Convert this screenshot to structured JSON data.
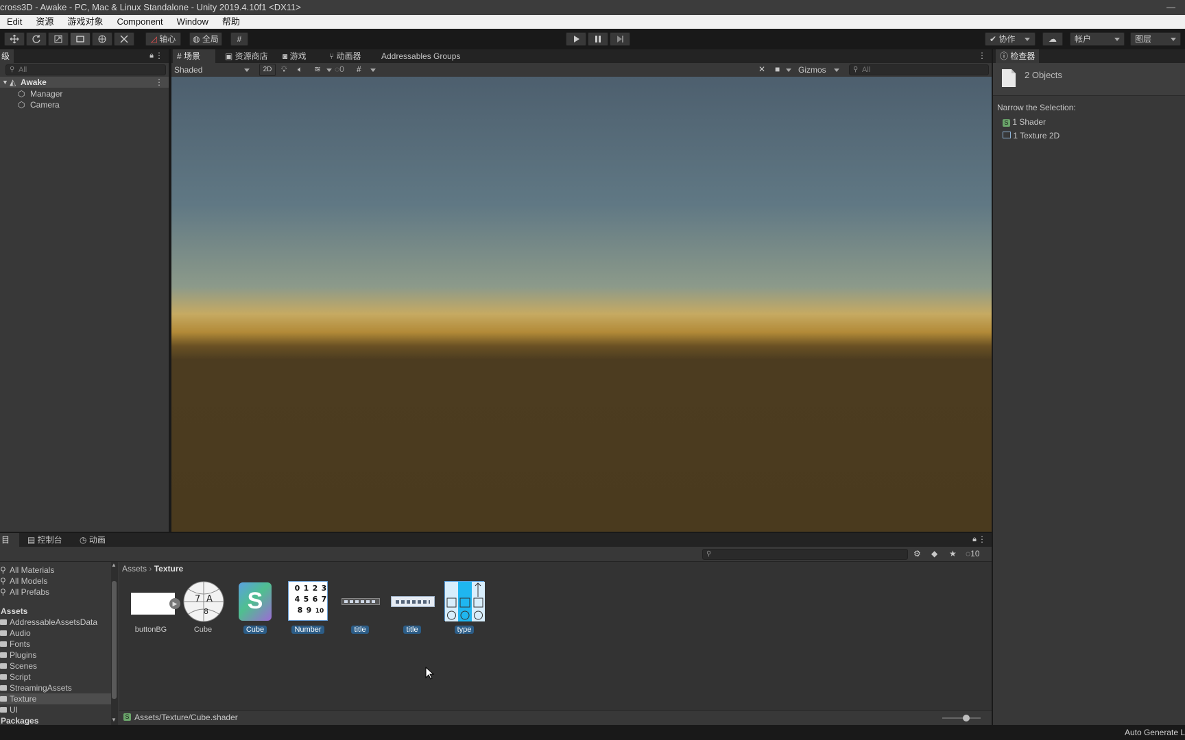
{
  "window": {
    "title": "cross3D - Awake - PC, Mac & Linux Standalone - Unity 2019.4.10f1 <DX11>",
    "minimize": "—"
  },
  "menubar": {
    "items": [
      "Edit",
      "资源",
      "游戏对象",
      "Component",
      "Window",
      "帮助"
    ]
  },
  "toolbar": {
    "pivot": "轴心",
    "global": "全局",
    "collab": "协作",
    "account": "帐户",
    "layers": "图层"
  },
  "hierarchy": {
    "tab_label": "级",
    "search_placeholder": "All",
    "scene": "Awake",
    "objects": [
      "Manager",
      "Camera"
    ]
  },
  "scene_view": {
    "tabs": [
      "场景",
      "资源商店",
      "游戏",
      "动画器",
      "Addressables Groups"
    ],
    "shading": "Shaded",
    "mode_2d": "2D",
    "hidden_count": "0",
    "gizmos": "Gizmos",
    "search_placeholder": "All"
  },
  "inspector": {
    "tab_label": "检查器",
    "summary": "2 Objects",
    "narrow_label": "Narrow the Selection:",
    "items": [
      "1 Shader",
      "1 Texture 2D"
    ]
  },
  "project": {
    "tabs": [
      "目",
      "控制台",
      "动画"
    ],
    "favorites": [
      "All Materials",
      "All Models",
      "All Prefabs"
    ],
    "assets_header": "Assets",
    "folders": [
      "AddressableAssetsData",
      "Audio",
      "Fonts",
      "Plugins",
      "Scenes",
      "Script",
      "StreamingAssets",
      "Texture",
      "UI"
    ],
    "selected_folder": "Texture",
    "packages_header": "Packages",
    "breadcrumb_root": "Assets",
    "breadcrumb_current": "Texture",
    "hidden_packages_count": "10",
    "assets": [
      {
        "name": "buttonBG",
        "selected": false
      },
      {
        "name": "Cube",
        "selected": false
      },
      {
        "name": "Cube",
        "selected": true
      },
      {
        "name": "Number",
        "selected": true
      },
      {
        "name": "title",
        "selected": true
      },
      {
        "name": "title",
        "selected": true
      },
      {
        "name": "type",
        "selected": true
      }
    ],
    "number_grid": [
      "0",
      "1",
      "2",
      "3",
      "4",
      "5",
      "6",
      "7",
      "8",
      "9",
      "10"
    ],
    "selected_path": "Assets/Texture/Cube.shader"
  },
  "statusbar": {
    "text": "Auto Generate L"
  },
  "colors": {
    "selection": "#2c5d87",
    "panel": "#383838",
    "toolbar": "#191919"
  }
}
